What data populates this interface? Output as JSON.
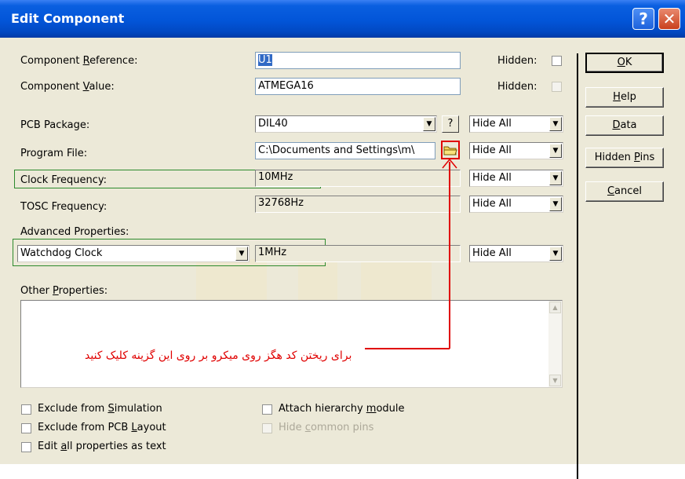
{
  "window": {
    "title": "Edit Component",
    "help_glyph": "?",
    "close_glyph": "✕"
  },
  "fields": {
    "component_reference": {
      "label_pre": "Component ",
      "label_u": "R",
      "label_post": "eference:",
      "value": "U1",
      "hidden_label": "Hidden:"
    },
    "component_value": {
      "label_pre": "Component ",
      "label_u": "V",
      "label_post": "alue:",
      "value": "ATMEGA16",
      "hidden_label": "Hidden:"
    },
    "pcb_package": {
      "label": "PCB Package:",
      "value": "DIL40",
      "help_button": "?",
      "visibility": "Hide All"
    },
    "program_file": {
      "label": "Program File:",
      "value": "C:\\Documents and Settings\\m\\",
      "visibility": "Hide All"
    },
    "clock_frequency": {
      "label": "Clock Frequency:",
      "value": "10MHz",
      "visibility": "Hide All"
    },
    "tosc_frequency": {
      "label": "TOSC Frequency:",
      "value": "32768Hz",
      "visibility": "Hide All"
    },
    "advanced_properties": {
      "label": "Advanced Properties:",
      "property": "Watchdog Clock",
      "value": "1MHz",
      "visibility": "Hide All"
    },
    "other_properties": {
      "label_pre": "Other ",
      "label_u": "P",
      "label_post": "roperties:"
    }
  },
  "checkboxes": {
    "exclude_simulation": {
      "pre": "Exclude from ",
      "u": "S",
      "post": "imulation"
    },
    "exclude_pcb": {
      "pre": "Exclude from PCB ",
      "u": "L",
      "post": "ayout"
    },
    "edit_all": {
      "pre": "Edit ",
      "u": "a",
      "post": "ll properties as text"
    },
    "attach_hierarchy": {
      "pre": "Attach hierarchy ",
      "u": "m",
      "post": "odule"
    },
    "hide_common_pins": {
      "pre": "Hide ",
      "u": "c",
      "post": "ommon pins"
    }
  },
  "buttons": {
    "ok": {
      "u": "O",
      "post": "K"
    },
    "help": {
      "u": "H",
      "post": "elp"
    },
    "data": {
      "u": "D",
      "post": "ata"
    },
    "hidden_pins": {
      "pre": "Hidden ",
      "u": "P",
      "post": "ins"
    },
    "cancel": {
      "u": "C",
      "post": "ancel"
    }
  },
  "annotation": {
    "persian_note": "برای ریختن کد هگز روی میکرو بر روی این گزینه کلیک کنید",
    "color": "#e00000"
  },
  "colors": {
    "titlebar": "#0255d8",
    "highlight_box": "#2d8a2d",
    "dialog_bg": "#ece9d8"
  }
}
